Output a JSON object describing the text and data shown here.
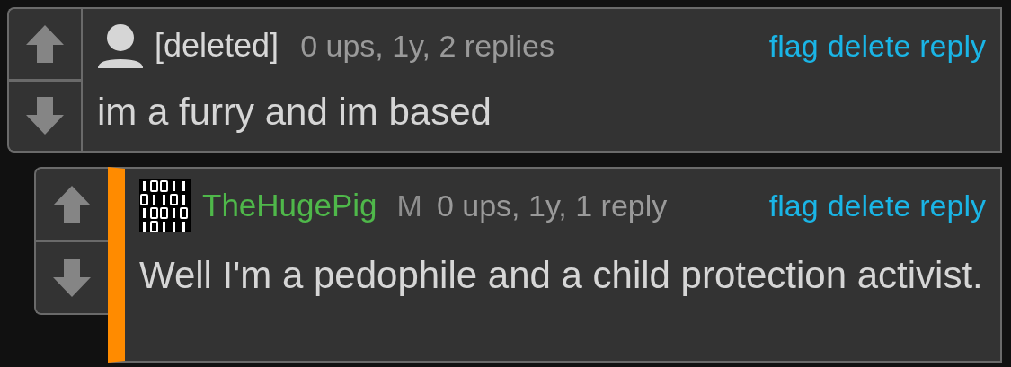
{
  "comments": [
    {
      "author": "[deleted]",
      "kind": "deleted",
      "meta": "0 ups, 1y, 2 replies",
      "actions": [
        "flag",
        "delete",
        "reply"
      ],
      "body": "im a furry and im based",
      "highlighted": false,
      "children": [
        {
          "author": "TheHugePig",
          "kind": "user",
          "badge": "M",
          "meta": "0 ups, 1y, 1 reply",
          "actions": [
            "flag",
            "delete",
            "reply"
          ],
          "body": "Well I'm a pedophile and a child protection activist.",
          "highlighted": true
        }
      ]
    }
  ]
}
